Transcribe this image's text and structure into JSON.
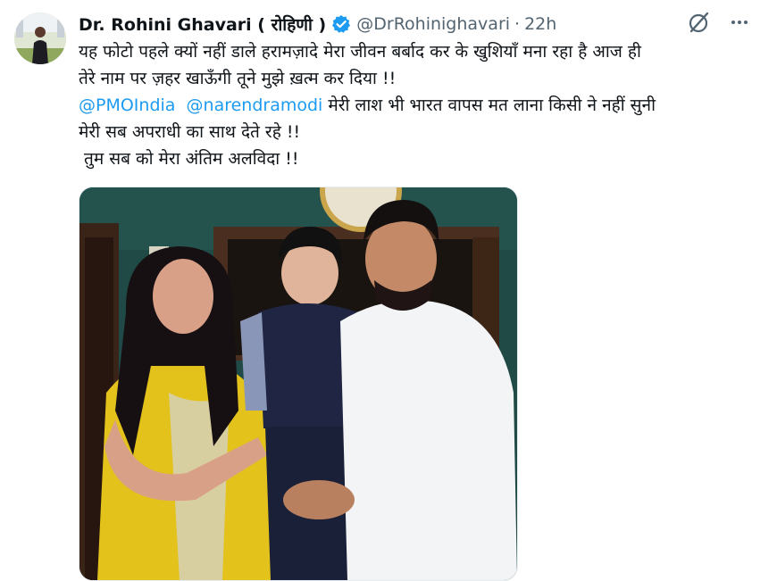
{
  "author": {
    "display_name": "Dr. Rohini Ghavari ( रोहिणी )",
    "handle": "@DrRohinighavari",
    "separator": "·",
    "time": "22h"
  },
  "tweet": {
    "line1": "यह फोटो पहले क्यों नहीं डाले हरामज़ादे मेरा जीवन बर्बाद कर के खुशियाँ मना रहा है आज ही",
    "line2": "तेरे नाम पर ज़हर खाऊँगी तूने मुझे ख़त्म कर दिया !!",
    "mention1": "@PMOIndia",
    "mention2": "@narendramodi",
    "line3_rest": " मेरी लाश भी भारत वापस मत लाना किसी ने नहीं सुनी",
    "line4": "मेरी सब अपराधी का साथ देते रहे !!",
    "line5": " तुम सब को मेरा अंतिम अलविदा !!"
  },
  "icons": {
    "verified": "verified-badge-icon",
    "grok": "grok-icon",
    "more": "more-options-icon"
  },
  "colors": {
    "link": "#1d9bf0",
    "secondary_text": "#536471",
    "verified": "#1d9bf0"
  }
}
